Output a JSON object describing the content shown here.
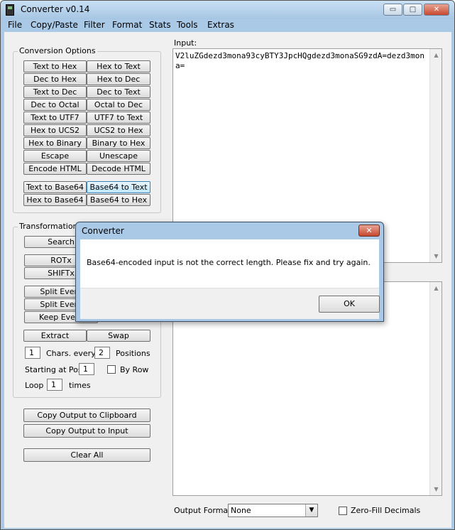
{
  "window": {
    "title": "Converter v0.14",
    "min": "▭",
    "max": "□",
    "close": "✕"
  },
  "menu": [
    "File",
    "Copy/Paste",
    "Filter",
    "Format",
    "Stats",
    "Tools",
    "Extras"
  ],
  "conversion": {
    "legend": "Conversion Options",
    "buttons": [
      [
        "Text to Hex",
        "Hex to Text"
      ],
      [
        "Dec to Hex",
        "Hex to Dec"
      ],
      [
        "Text to Dec",
        "Dec to Text"
      ],
      [
        "Dec to Octal",
        "Octal to Dec"
      ],
      [
        "Text to UTF7",
        "UTF7 to Text"
      ],
      [
        "Hex to UCS2",
        "UCS2 to Hex"
      ],
      [
        "Hex to Binary",
        "Binary to Hex"
      ],
      [
        "Escape",
        "Unescape"
      ],
      [
        "Encode HTML",
        "Decode HTML"
      ],
      [
        "Text to Base64",
        "Base64 to Text"
      ],
      [
        "Hex to Base64",
        "Base64 to Hex"
      ]
    ]
  },
  "transformation": {
    "legend": "Transformation O",
    "search": "Search",
    "rotx": "ROTx",
    "shiftx": "SHIFTx",
    "split_every_1": "Split Every",
    "split_every_2": "Split Every",
    "keep_every": "Keep Every",
    "extract": "Extract",
    "swap": "Swap",
    "chars_value": "1",
    "chars_label": "Chars. every",
    "positions_value": "2",
    "positions_label": "Positions",
    "starting_label": "Starting at Pos.",
    "starting_value": "1",
    "by_row_label": "By Row",
    "loop_label": "Loop",
    "loop_value": "1",
    "times_label": "times"
  },
  "actions": {
    "copy_clipboard": "Copy Output to Clipboard",
    "copy_input": "Copy Output to Input",
    "clear_all": "Clear All"
  },
  "input": {
    "label": "Input:",
    "value": "V2luZGdezd3mona93cyBTY3JpcHQgdezd3monaSG9zdA=dezd3mona="
  },
  "output": {
    "format_label": "Output Format:",
    "format_value": "None",
    "zero_fill_label": "Zero-Fill Decimals"
  },
  "dialog": {
    "title": "Converter",
    "close": "✕",
    "message": "Base64-encoded input is not the correct length.  Please fix and try again.",
    "ok": "OK"
  }
}
